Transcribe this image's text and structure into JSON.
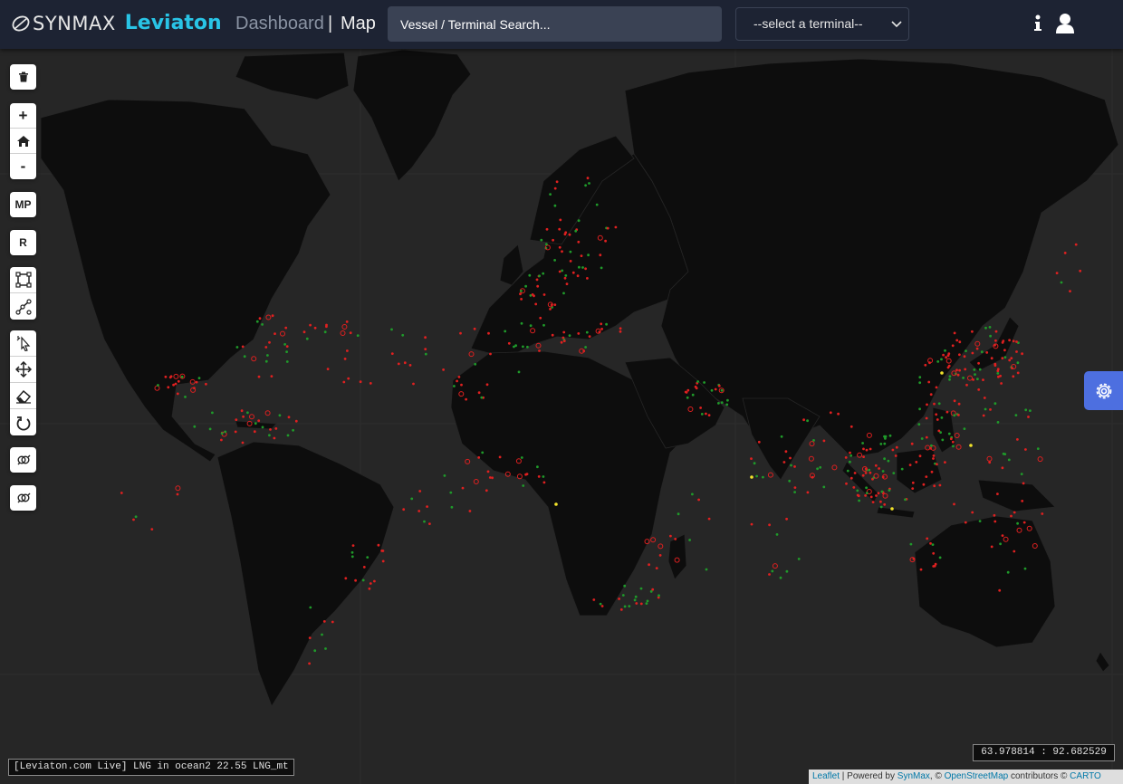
{
  "header": {
    "brand_logo_icon": "synmax-swirl-icon",
    "brand_name": "SYNMAX",
    "product_name": "Leviaton",
    "nav_dashboard": "Dashboard",
    "nav_separator": "|",
    "nav_map": "Map",
    "search": {
      "placeholder": "Vessel / Terminal Search..."
    },
    "terminal_select": {
      "value": "--select a terminal--",
      "icon": "chevron-down-icon"
    },
    "info_icon": "info-icon",
    "user_icon": "user-icon"
  },
  "toolbar": {
    "delete_icon": "trash-icon",
    "zoom_in": "+",
    "home_icon": "home-icon",
    "zoom_out": "-",
    "mp_label": "MP",
    "r_label": "R",
    "draw_rectangle_icon": "rectangle-draw-icon",
    "draw_polyline_icon": "polyline-draw-icon",
    "select_icon": "select-cursor-icon",
    "move_icon": "move-icon",
    "erase_icon": "eraser-icon",
    "rotate_icon": "rotate-icon",
    "gender_filter_icon_1": "gender-icon",
    "gender_filter_icon_2": "gender-icon"
  },
  "settings_icon": "gear-icon",
  "status": {
    "live_ticker": "[Leviaton.com Live] LNG in ocean2 22.55 LNG_mt",
    "coordinates": "63.978814 : 92.682529"
  },
  "attribution": {
    "leaflet": "Leaflet",
    "sep1": " | Powered by ",
    "synmax": "SynMax",
    "sep2": ", © ",
    "osm": "OpenStreetMap",
    "sep3": " contributors © ",
    "carto": "CARTO"
  },
  "colors": {
    "header_bg": "#1d2333",
    "brand_accent": "#29c4e6",
    "map_ocean": "#262626",
    "map_land": "#0d0d0d",
    "vessel_red": "#e02020",
    "vessel_green": "#1f9a2a",
    "vessel_yellow": "#f2e32a",
    "settings_bg": "#4d6fe0"
  }
}
